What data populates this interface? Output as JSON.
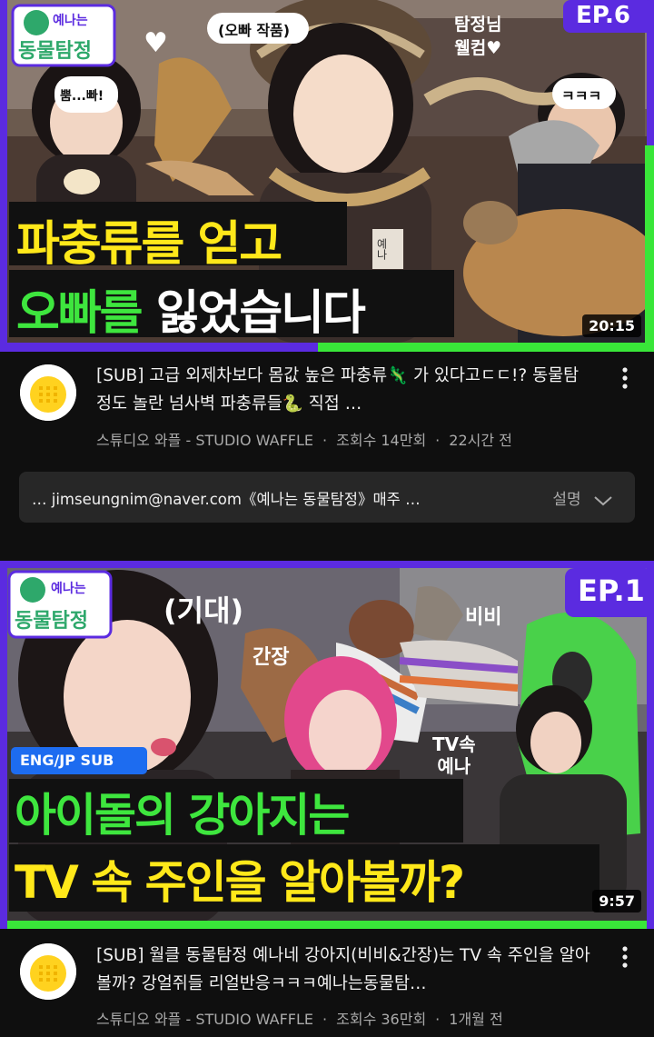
{
  "videos": [
    {
      "thumbnail": {
        "show_logo_line1": "예나는",
        "show_logo_line2": "동물탐정",
        "episode": "EP.6",
        "caption_line1": "파충류를 얻고",
        "caption_line2_green": "오빠를",
        "caption_line2_white": "잃었습니다",
        "bubble_top": "(오빠 작품)",
        "bubble_left": "뿜...빠!",
        "bubble_right_line1": "탐정님",
        "bubble_right_line2": "웰컴♥",
        "bubble_laugh": "ㅋㅋㅋ",
        "name_tag": "예나",
        "heart": "♥"
      },
      "duration": "20:15",
      "title": "[SUB] 고급 외제차보다 몸값 높은 파충류🦎 가 있다고ㄷㄷ!? 동물탐정도 놀란 넘사벽 파충류들🐍 직접 …",
      "channel": "스튜디오 와플 - STUDIO WAFFLE",
      "views": "조회수 14만회",
      "age": "22시간 전",
      "description": "… jimseungnim@naver.com《예나는 동물탐정》매주 …",
      "description_more": "설명"
    },
    {
      "thumbnail": {
        "show_logo_line1": "예나는",
        "show_logo_line2": "동물탐정",
        "episode": "EP.1",
        "sub_badge": "ENG/JP SUB",
        "caption_line1": "아이돌의 강아지는",
        "caption_line2": "TV 속 주인을 알아볼까?",
        "bubble_expect": "(기대)",
        "label_ganjang": "간장",
        "label_bibi": "비비",
        "label_tv_line1": "TV속",
        "label_tv_line2": "예나"
      },
      "duration": "9:57",
      "title": "[SUB] 월클 동물탐정 예나네 강아지(비비&간장)는 TV 속 주인을 알아볼까? 강얼쥐들 리얼반응ㅋㅋㅋ예나는동물탐…",
      "channel": "스튜디오 와플 - STUDIO WAFFLE",
      "views": "조회수 36만회",
      "age": "1개월 전"
    }
  ],
  "icons": {
    "more": "more-vert-icon",
    "expand": "chevron-down-icon",
    "avatar": "waffle-logo-icon"
  },
  "colors": {
    "background": "#0f0f0f",
    "frame_purple": "#5b2be0",
    "frame_green": "#39e639",
    "caption_yellow": "#ffe81a",
    "caption_green": "#3ee63e"
  }
}
